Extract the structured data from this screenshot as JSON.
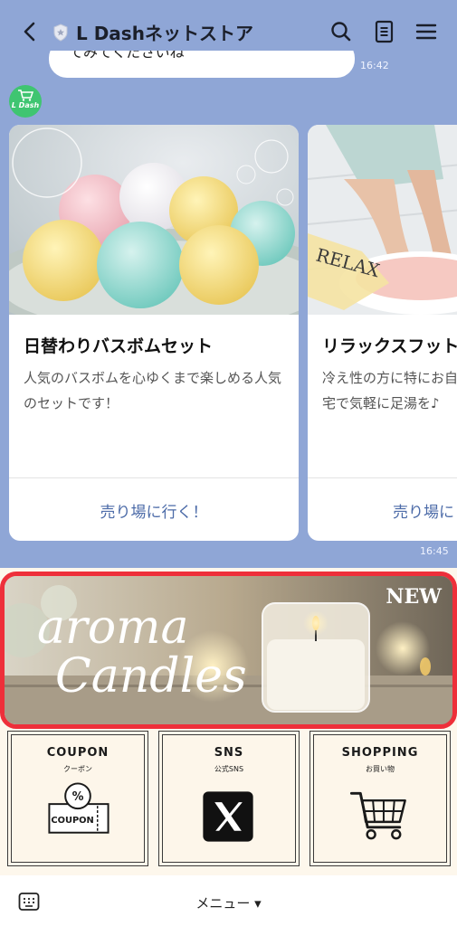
{
  "header": {
    "title": "L Dashネットストア",
    "icons": [
      "back-chevron-icon",
      "shield-icon",
      "search-icon",
      "notes-icon",
      "menu-icon"
    ]
  },
  "chat": {
    "previous_message_fragment": "てみてくださいね",
    "previous_time": "16:42",
    "avatar_label": "L Dash",
    "cards": [
      {
        "title": "日替わりバスボムセット",
        "description": "人気のバスボムを心ゆくまで楽しめる人気のセットです！",
        "link": "売り場に行く！",
        "image": "bath-bombs-photo"
      },
      {
        "title": "リラックスフット",
        "description": "冷え性の方に特にお自宅で気軽に足湯を♪",
        "link": "売り場に",
        "image": "relax-footbath-photo"
      }
    ],
    "carousel_time": "16:45"
  },
  "richmenu": {
    "banner": {
      "badge": "NEW",
      "script_line1": "aroma",
      "script_line2": "Candles"
    },
    "tiles": [
      {
        "title": "COUPON",
        "subtitle": "クーポン",
        "icon_text": "COUPON",
        "icon": "coupon-ticket-icon"
      },
      {
        "title": "SNS",
        "subtitle": "公式SNS",
        "icon": "x-logo-icon"
      },
      {
        "title": "SHOPPING",
        "subtitle": "お買い物",
        "icon": "shopping-cart-icon"
      }
    ],
    "colors": {
      "highlight_border": "#ee2f3a",
      "tile_bg": "#fdf6ea",
      "chat_bg": "#8fa6d6"
    }
  },
  "bottombar": {
    "menu_label": "メニュー ▾",
    "icon": "keyboard-icon"
  }
}
